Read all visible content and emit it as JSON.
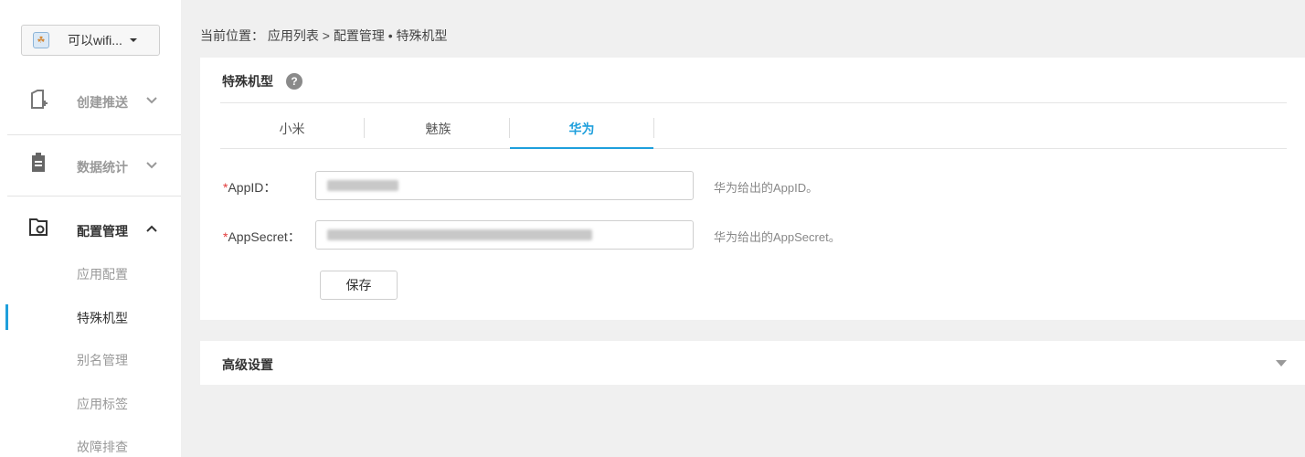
{
  "sidebar": {
    "app_selector": {
      "avatar": "app-avatar-icon",
      "name": "可以wifi..."
    },
    "nav": [
      {
        "label": "创建推送",
        "icon": "create-push-icon",
        "expanded": false
      },
      {
        "label": "数据统计",
        "icon": "clipboard-icon",
        "expanded": false
      },
      {
        "label": "配置管理",
        "icon": "config-folder-icon",
        "expanded": true
      }
    ],
    "sub_items": [
      {
        "label": "应用配置"
      },
      {
        "label": "特殊机型"
      },
      {
        "label": "别名管理"
      },
      {
        "label": "应用标签"
      },
      {
        "label": "故障排查"
      }
    ],
    "active_sub_index": 1
  },
  "breadcrumb": "当前位置： 应用列表 > 配置管理 • 特殊机型",
  "panel": {
    "title": "特殊机型",
    "help_symbol": "?",
    "tabs": [
      {
        "label": "小米"
      },
      {
        "label": "魅族"
      },
      {
        "label": "华为"
      }
    ],
    "active_tab": 2,
    "fields": [
      {
        "required_mark": "*",
        "label": "AppID：",
        "hint": "华为给出的AppID。",
        "blurred": true
      },
      {
        "required_mark": "*",
        "label": "AppSecret：",
        "hint": "华为给出的AppSecret。",
        "blurred": true
      }
    ],
    "save_label": "保存"
  },
  "advanced": {
    "title": "高级设置",
    "expanded": false
  },
  "colors": {
    "accent": "#1e9fdc",
    "required": "#e23b3b",
    "background": "#f0f0f0"
  }
}
